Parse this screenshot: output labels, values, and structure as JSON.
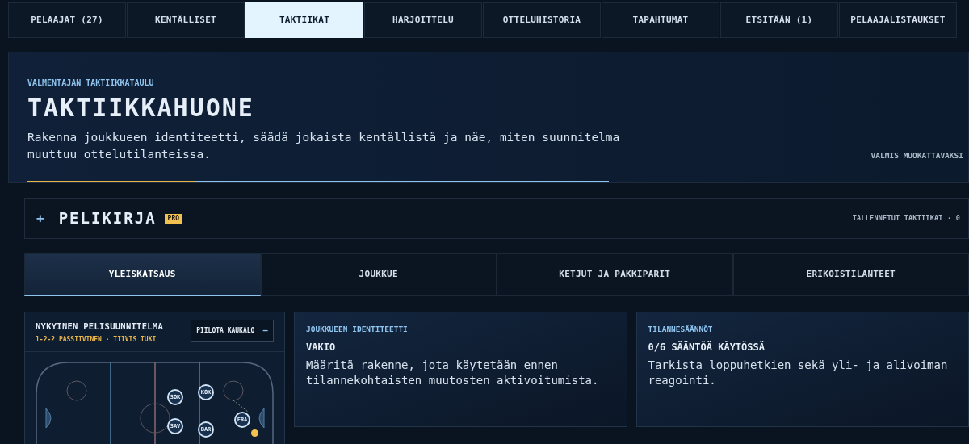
{
  "tabs": [
    {
      "label": "PELAAJAT (27)",
      "selected": false
    },
    {
      "label": "KENTÄLLISET",
      "selected": false
    },
    {
      "label": "TAKTIIKAT",
      "selected": true
    },
    {
      "label": "HARJOITTELU",
      "selected": false
    },
    {
      "label": "OTTELUHISTORIA",
      "selected": false
    },
    {
      "label": "TAPAHTUMAT",
      "selected": false
    },
    {
      "label": "ETSITÄÄN (1)",
      "selected": false
    },
    {
      "label": "PELAAJALISTAUKSET",
      "selected": false
    }
  ],
  "hero": {
    "eyebrow": "VALMENTAJAN TAKTIIKKATAULU",
    "title": "TAKTIIKKAHUONE",
    "description": "Rakenna joukkueen identiteetti, säädä jokaista kentällistä ja näe, miten suunnitelma muuttuu ottelutilanteissa.",
    "status": "VALMIS MUOKATTAVAKSI",
    "progress": {
      "level": 0.29
    }
  },
  "playbook": {
    "icon_text": "+",
    "title": "PELIKIRJA",
    "badge": "PRO",
    "saved": "TALLENNETUT TAKTIIKAT · 0"
  },
  "subtabs": [
    {
      "label": "YLEISKATSAUS",
      "selected": true
    },
    {
      "label": "JOUKKUE",
      "selected": false
    },
    {
      "label": "KETJUT JA PAKKIPARIT",
      "selected": false
    },
    {
      "label": "ERIKOISTILANTEET",
      "selected": false
    }
  ],
  "plan": {
    "title": "NYKYINEN PELISUUNNITELMA",
    "subtitle": "1-2-2 PASSIIVINEN · TIIVIS TUKI",
    "toggle": {
      "label": "PIILOTA KAUKALO",
      "icon_text": "−"
    },
    "players": [
      {
        "label": "SOK"
      },
      {
        "label": "KOK"
      },
      {
        "label": "FRA"
      },
      {
        "label": "SAV"
      },
      {
        "label": "BAR"
      }
    ]
  },
  "cards": [
    {
      "eyebrow": "JOUKKUEEN IDENTITEETTI",
      "title": "VAKIO",
      "text": "Määritä rakenne, jota käytetään ennen tilannekohtaisten muutosten aktivoitumista."
    },
    {
      "eyebrow": "TILANNESÄÄNNÖT",
      "title": "0/6 SÄÄNTÖÄ KÄYTÖSSÄ",
      "text": "Tarkista loppuhetkien sekä yli- ja alivoiman reagointi."
    }
  ]
}
